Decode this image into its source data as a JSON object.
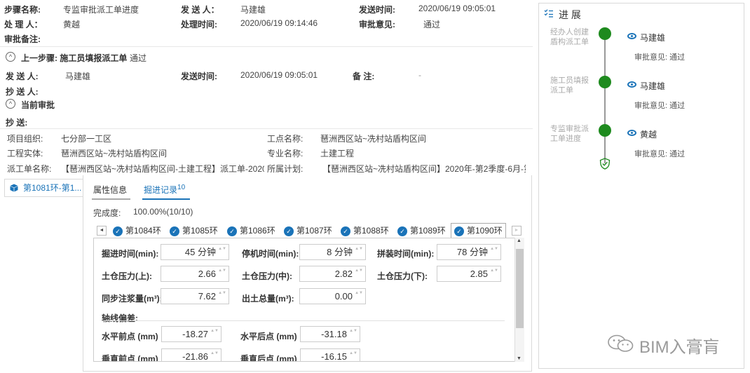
{
  "header": {
    "step_name_label": "步骤名称:",
    "step_name_value": "专监审批派工单进度",
    "sender_label": "发 送 人：",
    "sender_value": "马建雄",
    "send_time_label": "发送时间:",
    "send_time_value": "2020/06/19 09:05:01",
    "handler_label": "处 理 人：",
    "handler_value": "黄越",
    "handle_time_label": "处理时间:",
    "handle_time_value": "2020/06/19 09:14:46",
    "opinion_label": "审批意见:",
    "opinion_value": "通过",
    "remark_label": "审批备注:"
  },
  "prev_step": {
    "toggle_glyph": "^",
    "title": "上一步骤: 施工员填报派工单",
    "status": "通过",
    "sender_label": "发 送 人:",
    "sender_value": "马建雄",
    "send_time_label": "发送时间:",
    "send_time_value": "2020/06/19 09:05:01",
    "note_label": "备    注:",
    "note_value": "-",
    "cc_label": "抄 送 人:"
  },
  "current": {
    "toggle_glyph": "^",
    "title": "当前审批",
    "cc_label": "抄    送:"
  },
  "project": {
    "org_label": "项目组织:",
    "org_value": "七分部一工区",
    "site_label": "工点名称:",
    "site_value": "琶洲西区站~冼村站盾构区间",
    "entity_label": "工程实体:",
    "entity_value": "琶洲西区站~冼村站盾构区间",
    "major_label": "专业名称:",
    "major_value": "土建工程",
    "order_label": "派工单名称:",
    "order_value": "【琶洲西区站~冼村站盾构区间-土建工程】派工单-2020/0€",
    "plan_label": "所属计划:",
    "plan_value": "【琶洲西区站~冼村站盾构区间】2020年-第2季度-6月-第3]"
  },
  "left_list": {
    "icon": "cube-icon",
    "item_label": "第1081环-第1..."
  },
  "tabs": {
    "attr_label": "属性信息",
    "progress_label": "掘进记录",
    "progress_badge": "10",
    "active": "progress"
  },
  "completion": {
    "label": "完成度:",
    "value": "100.00%(10/10)",
    "percent": 100
  },
  "ring_tabs": {
    "left_arrow": "◄",
    "right_arrow": "►",
    "check": "✓",
    "items": [
      "第1084环",
      "第1085环",
      "第1086环",
      "第1087环",
      "第1088环",
      "第1089环",
      "第1090环"
    ],
    "active_index": 6
  },
  "form": {
    "dig_time_label": "掘进时间(min):",
    "dig_time_value": "45 分钟",
    "stop_time_label": "停机时间(min):",
    "stop_time_value": "8 分钟",
    "assemble_time_label": "拼装时间(min):",
    "assemble_time_value": "78 分钟",
    "p_up_label": "土仓压力(上):",
    "p_up_value": "2.66",
    "p_mid_label": "土仓压力(中):",
    "p_mid_value": "2.82",
    "p_down_label": "土仓压力(下):",
    "p_down_value": "2.85",
    "grout_label": "同步注浆量(m³):",
    "grout_value": "7.62",
    "soil_label": "出土总量(m³):",
    "soil_value": "0.00",
    "axis_label": "轴线偏差:",
    "h_front_label": "水平前点 (mm)",
    "h_front_value": "-18.27",
    "h_back_label": "水平后点 (mm)",
    "h_back_value": "-31.18",
    "v_front_label": "垂直前点 (mm)",
    "v_front_value": "-21.86",
    "v_back_label": "垂直后点 (mm)",
    "v_back_value": "-16.15",
    "spin_glyph": "▲▼"
  },
  "progress_panel": {
    "icon": "list-check-icon",
    "title": "进 展",
    "steps": [
      {
        "step": "经办人创建盾构派工单",
        "name": "马建雄",
        "opinion": "审批意见: 通过"
      },
      {
        "step": "施工员填报派工单",
        "name": "马建雄",
        "opinion": "审批意见: 通过"
      },
      {
        "step": "专监审批派工单进度",
        "name": "黄越",
        "opinion": "审批意见: 通过"
      }
    ],
    "end_icon": "shield-check-icon"
  },
  "watermark": {
    "text": "BIM入膏肓",
    "icon": "wechat-icon"
  },
  "colors": {
    "accent": "#1a73b8",
    "success": "#1e8a1e"
  }
}
